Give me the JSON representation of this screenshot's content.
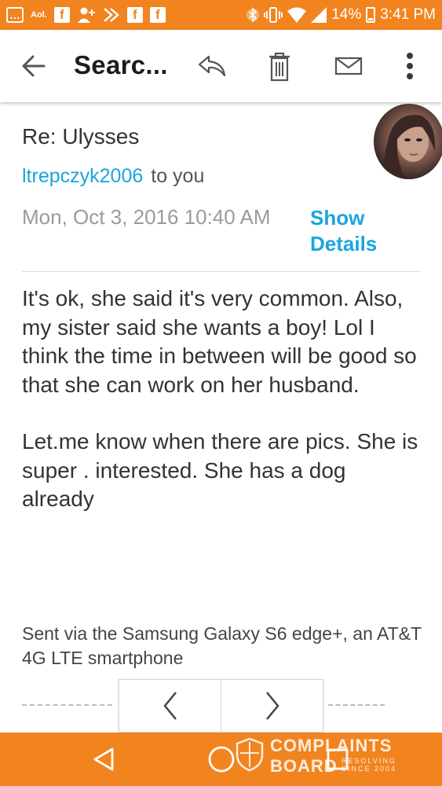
{
  "status_bar": {
    "aol_label": "Aol.",
    "battery_percent": "14%",
    "time": "3:41 PM",
    "icons": [
      "chat-icon",
      "aol-icon",
      "facebook-icon",
      "add-friend-icon",
      "forward-arrows-icon",
      "facebook-icon",
      "facebook-icon",
      "bluetooth-icon",
      "vibrate-icon",
      "wifi-icon",
      "signal-icon",
      "battery-icon"
    ]
  },
  "app_bar": {
    "title": "Searc...",
    "actions": [
      "back-arrow-icon",
      "reply-icon",
      "trash-icon",
      "mail-icon",
      "more-vert-icon"
    ]
  },
  "message": {
    "subject": "Re: Ulysses",
    "sender": "ltrepczyk2006",
    "recipient_text": "to you",
    "datetime": "Mon, Oct 3, 2016 10:40 AM",
    "show_details": "Show Details",
    "body_paragraphs": [
      "It's ok, she said it's very common. Also, my sister said she wants a boy! Lol I think the time in between will be good so that she can work on her husband.",
      "Let.me know when there are pics. She is super . interested. She has a dog already"
    ],
    "signature": "Sent via the Samsung Galaxy S6 edge+, an AT&T 4G LTE smartphone"
  },
  "pager": {
    "prev_icon": "chevron-left-icon",
    "next_icon": "chevron-right-icon"
  },
  "nav_bar": {
    "buttons": [
      "back-triangle-icon",
      "home-circle-icon",
      "recents-square-icon"
    ]
  },
  "watermark": {
    "line1": "COMPLAINTS",
    "line2": "BOARD",
    "tagline": "RESOLVING SINCE 2004"
  },
  "colors": {
    "accent": "#f2841f",
    "link": "#1ba5dc"
  }
}
